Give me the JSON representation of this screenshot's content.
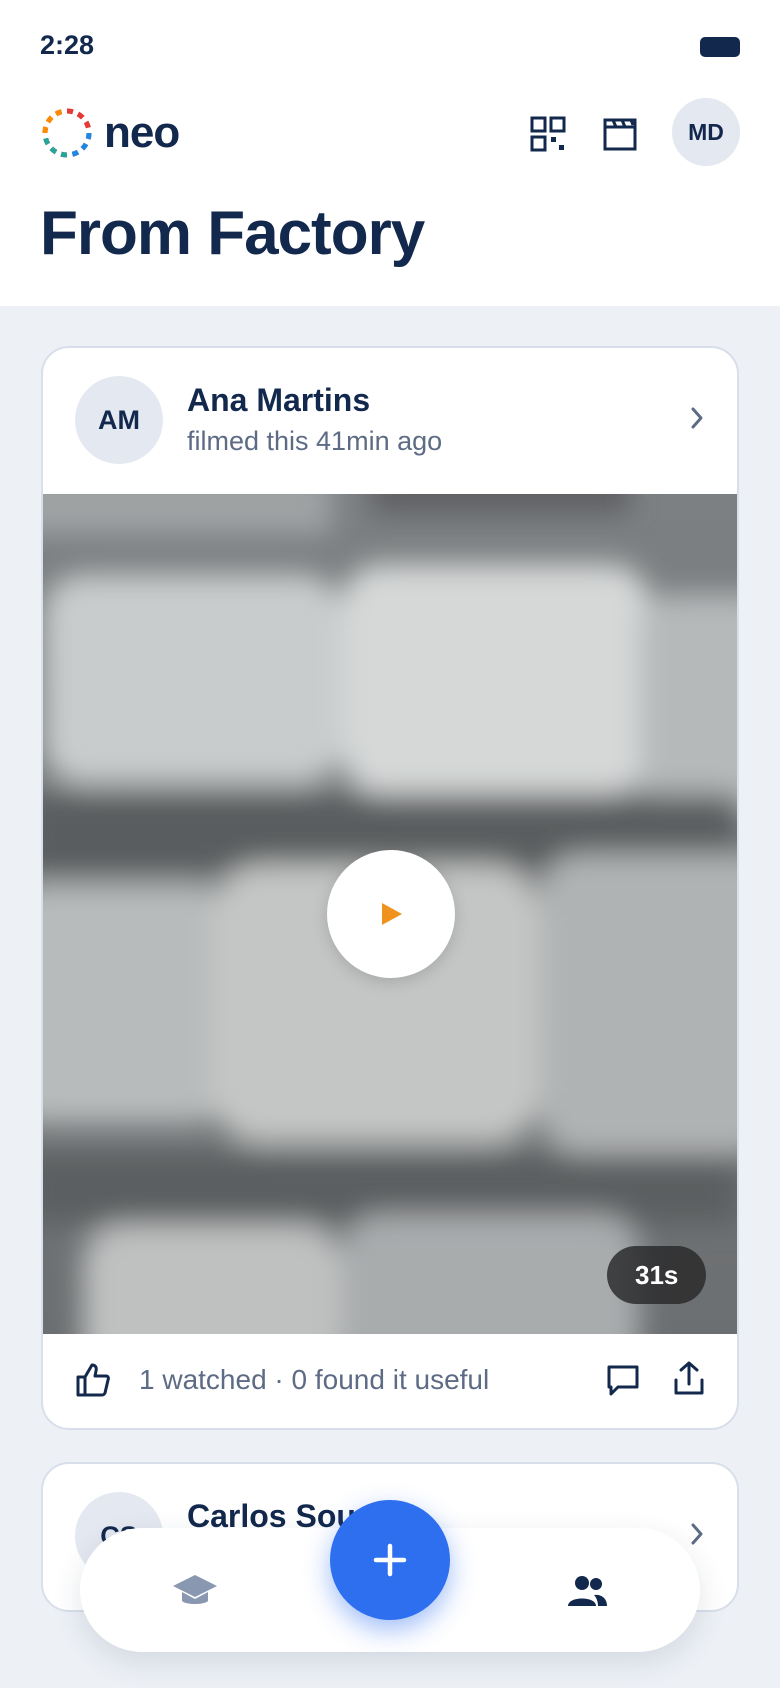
{
  "status_bar": {
    "time": "2:28"
  },
  "header": {
    "logo_text": "neo",
    "user_initials": "MD",
    "icons": [
      "qr-code-icon",
      "clapperboard-icon"
    ],
    "page_title": "From Factory"
  },
  "feed": {
    "posts": [
      {
        "initials": "AM",
        "author": "Ana Martins",
        "meta": "filmed this 41min ago",
        "duration": "31s",
        "stats": "1 watched · 0 found it useful"
      },
      {
        "initials": "CS",
        "author": "Carlos Sou"
      }
    ]
  },
  "nav": {
    "items": [
      "learn-icon",
      "add-icon",
      "people-icon"
    ]
  },
  "colors": {
    "primary": "#2e6fef",
    "text": "#13284d",
    "muted": "#5d6b85",
    "play": "#f0921e",
    "background": "#edf1f6"
  }
}
